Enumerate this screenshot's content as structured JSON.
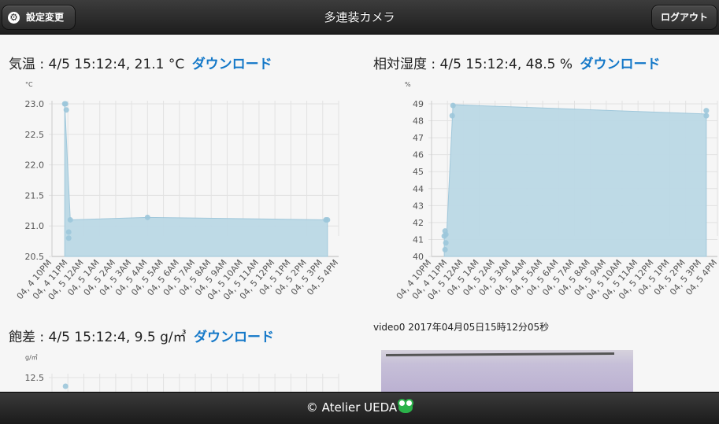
{
  "header": {
    "title": "多連装カメラ",
    "settings_label": "設定変更",
    "logout_label": "ログアウト",
    "settings_icon": "gear-icon"
  },
  "panels": {
    "temp": {
      "title": "気温 : 4/5 15:12:4, 21.1 °C",
      "download": "ダウンロード",
      "unit": "°C"
    },
    "humidity": {
      "title": "相対湿度 : 4/5 15:12:4, 48.5 %",
      "download": "ダウンロード",
      "unit": "%"
    },
    "deficit": {
      "title": "飽差 : 4/5 15:12:4, 9.5 g/㎥",
      "download": "ダウンロード",
      "unit": "g/㎥"
    }
  },
  "video": {
    "label": "video0 2017年04月05日15時12分05秒"
  },
  "footer": {
    "text": "© Atelier UEDA"
  },
  "colors": {
    "accent": "#1478c8",
    "area_fill": "#bcd9e6",
    "area_stroke": "#9cc6da",
    "point": "#9cc6da"
  },
  "chart_data": [
    {
      "type": "area",
      "id": "temp",
      "ylabel": "°C",
      "xticks": [
        "04, 4 10PM",
        "04, 4 11PM",
        "04, 5 12AM",
        "04, 5 1AM",
        "04, 5 2AM",
        "04, 5 3AM",
        "04, 5 4AM",
        "04, 5 5AM",
        "04, 5 6AM",
        "04, 5 7AM",
        "04, 5 8AM",
        "04, 5 9AM",
        "04, 5 10AM",
        "04, 5 11AM",
        "04, 5 12PM",
        "04, 5 1PM",
        "04, 5 2PM",
        "04, 5 3PM",
        "04, 5 4PM"
      ],
      "yticks": [
        "20.5",
        "21.0",
        "21.5",
        "22.0",
        "22.5",
        "23.0"
      ],
      "ylim": [
        20.5,
        23.0
      ],
      "grid": true,
      "points": [
        {
          "x": 0.8,
          "y": 23.0
        },
        {
          "x": 0.85,
          "y": 23.0
        },
        {
          "x": 0.9,
          "y": 22.9
        },
        {
          "x": 1.05,
          "y": 20.9
        },
        {
          "x": 1.05,
          "y": 20.8
        },
        {
          "x": 1.15,
          "y": 21.1
        },
        {
          "x": 6.0,
          "y": 21.14
        },
        {
          "x": 17.2,
          "y": 21.1
        },
        {
          "x": 17.3,
          "y": 21.1
        }
      ],
      "area": [
        {
          "x": 0.8,
          "y": 23.0
        },
        {
          "x": 1.15,
          "y": 21.1
        },
        {
          "x": 6.0,
          "y": 21.14
        },
        {
          "x": 17.3,
          "y": 21.1
        }
      ]
    },
    {
      "type": "area",
      "id": "humidity",
      "ylabel": "%",
      "xticks": [
        "04, 4 10PM",
        "04, 4 11PM",
        "04, 5 12AM",
        "04, 5 1AM",
        "04, 5 2AM",
        "04, 5 3AM",
        "04, 5 4AM",
        "04, 5 5AM",
        "04, 5 6AM",
        "04, 5 7AM",
        "04, 5 8AM",
        "04, 5 9AM",
        "04, 5 10AM",
        "04, 5 11AM",
        "04, 5 12PM",
        "04, 5 1PM",
        "04, 5 2PM",
        "04, 5 3PM",
        "04, 5 4PM"
      ],
      "yticks": [
        "40",
        "41",
        "42",
        "43",
        "44",
        "45",
        "46",
        "47",
        "48",
        "49"
      ],
      "ylim": [
        40,
        49
      ],
      "grid": true,
      "points": [
        {
          "x": 0.8,
          "y": 41.2
        },
        {
          "x": 0.85,
          "y": 41.5
        },
        {
          "x": 0.9,
          "y": 41.3
        },
        {
          "x": 0.85,
          "y": 40.4
        },
        {
          "x": 0.9,
          "y": 40.8
        },
        {
          "x": 1.3,
          "y": 48.3
        },
        {
          "x": 1.35,
          "y": 48.9
        },
        {
          "x": 17.3,
          "y": 48.3
        },
        {
          "x": 17.3,
          "y": 48.6
        }
      ],
      "area": [
        {
          "x": 0.8,
          "y": 41.2
        },
        {
          "x": 0.95,
          "y": 41.3
        },
        {
          "x": 1.35,
          "y": 48.95
        },
        {
          "x": 17.3,
          "y": 48.4
        }
      ]
    },
    {
      "type": "area",
      "id": "deficit",
      "ylabel": "g/㎥",
      "yticks": [
        "12.5"
      ],
      "ylim": [
        10.0,
        12.5
      ],
      "grid": true,
      "points": [
        {
          "x": 0.85,
          "y": 12.3
        }
      ],
      "area": []
    }
  ]
}
